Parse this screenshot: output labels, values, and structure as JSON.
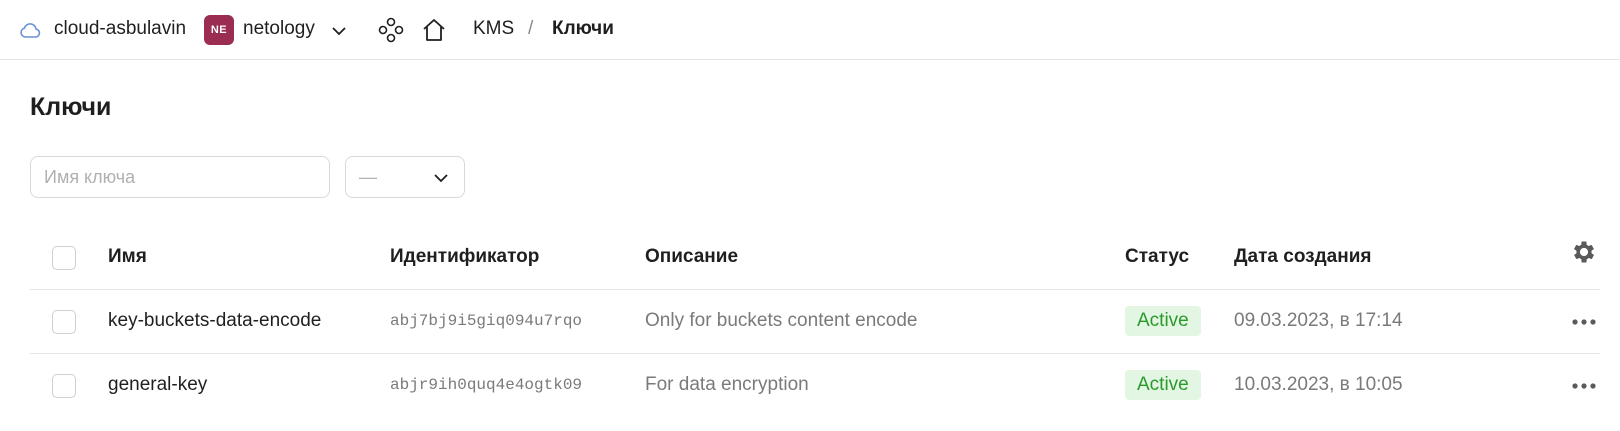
{
  "topbar": {
    "cloud_name": "cloud-asbulavin",
    "folder_badge": "NE",
    "folder_name": "netology",
    "breadcrumb": {
      "service": "KMS",
      "separator": "/",
      "current": "Ключи"
    }
  },
  "page": {
    "title": "Ключи"
  },
  "filters": {
    "search_placeholder": "Имя ключа",
    "status_value": "—"
  },
  "table": {
    "columns": {
      "name": "Имя",
      "id": "Идентификатор",
      "description": "Описание",
      "status": "Статус",
      "created": "Дата создания"
    },
    "rows": [
      {
        "name": "key-buckets-data-encode",
        "id": "abj7bj9i5giq094u7rqo",
        "description": "Only for buckets content encode",
        "status": "Active",
        "created": "09.03.2023, в 17:14"
      },
      {
        "name": "general-key",
        "id": "abjr9ih0quq4e4ogtk09",
        "description": "For data encryption",
        "status": "Active",
        "created": "10.03.2023, в 10:05"
      }
    ]
  },
  "colors": {
    "accent_badge": "#9b2c52",
    "status_active_bg": "#e3f6e3",
    "status_active_text": "#2a9a2a",
    "cloud_icon": "#6b8fd6"
  },
  "icons": [
    "cloud-icon",
    "chevron-down-icon",
    "services-icon",
    "home-icon",
    "gear-icon",
    "more-icon"
  ]
}
